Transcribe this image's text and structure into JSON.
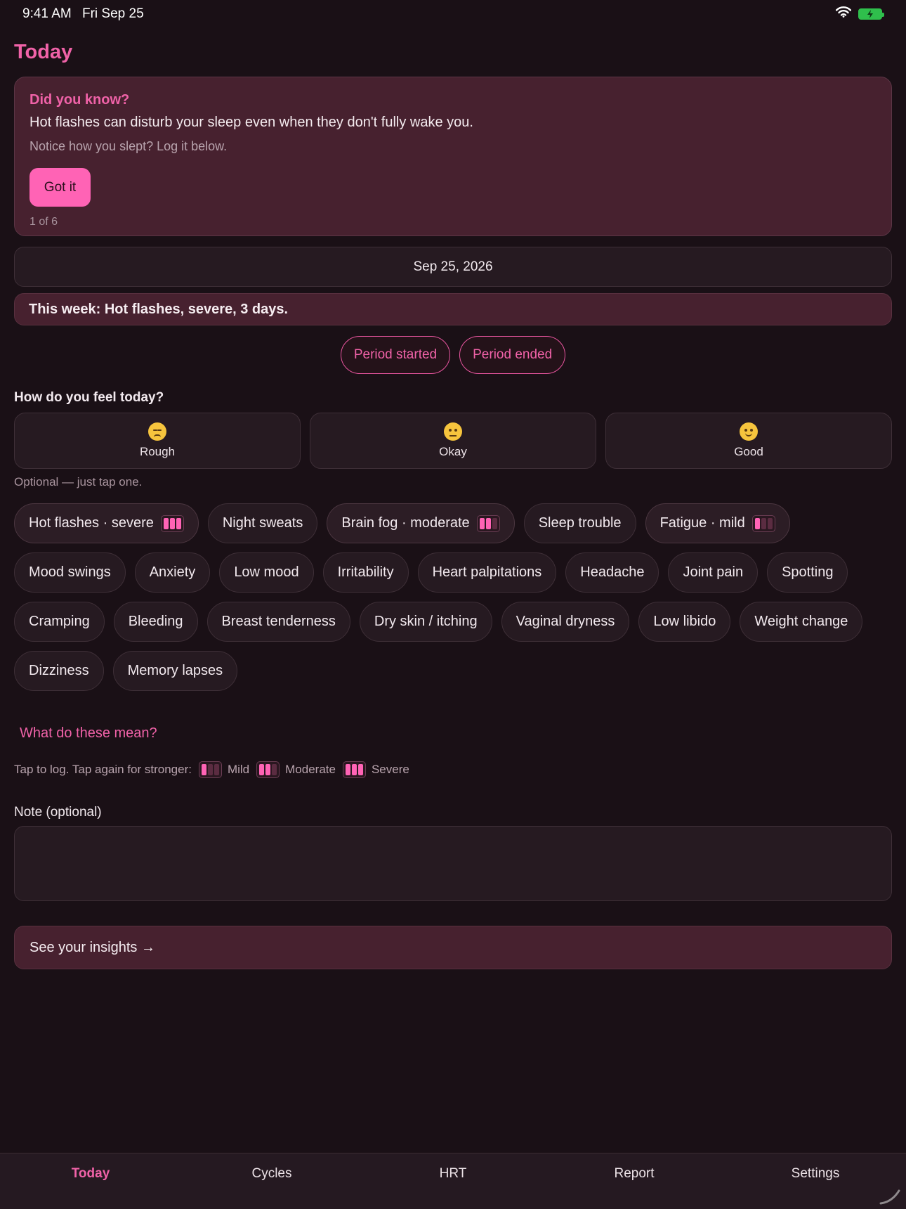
{
  "status_bar": {
    "time": "9:41 AM",
    "date": "Fri Sep 25"
  },
  "page_title": "Today",
  "tip": {
    "heading": "Did you know?",
    "body": "Hot flashes can disturb your sleep even when they don't fully wake you.",
    "sub": "Notice how you slept? Log it below.",
    "button": "Got it",
    "counter": "1 of 6"
  },
  "date": "Sep 25, 2026",
  "week_summary": "This week: Hot flashes, severe, 3 days.",
  "period": {
    "started": "Period started",
    "ended": "Period ended"
  },
  "feel": {
    "label": "How do you feel today?",
    "options": [
      {
        "label": "Rough",
        "icon": "persevering-face-icon"
      },
      {
        "label": "Okay",
        "icon": "neutral-face-icon"
      },
      {
        "label": "Good",
        "icon": "slightly-smiling-face-icon"
      }
    ],
    "hint": "Optional — just tap one."
  },
  "symptoms": [
    {
      "label": "Hot flashes · severe",
      "severity": 3
    },
    {
      "label": "Night sweats",
      "severity": 0
    },
    {
      "label": "Brain fog · moderate",
      "severity": 2
    },
    {
      "label": "Sleep trouble",
      "severity": 0
    },
    {
      "label": "Fatigue · mild",
      "severity": 1
    },
    {
      "label": "Mood swings",
      "severity": 0
    },
    {
      "label": "Anxiety",
      "severity": 0
    },
    {
      "label": "Low mood",
      "severity": 0
    },
    {
      "label": "Irritability",
      "severity": 0
    },
    {
      "label": "Heart palpitations",
      "severity": 0
    },
    {
      "label": "Headache",
      "severity": 0
    },
    {
      "label": "Joint pain",
      "severity": 0
    },
    {
      "label": "Spotting",
      "severity": 0
    },
    {
      "label": "Cramping",
      "severity": 0
    },
    {
      "label": "Bleeding",
      "severity": 0
    },
    {
      "label": "Breast tenderness",
      "severity": 0
    },
    {
      "label": "Dry skin / itching",
      "severity": 0
    },
    {
      "label": "Vaginal dryness",
      "severity": 0
    },
    {
      "label": "Low libido",
      "severity": 0
    },
    {
      "label": "Weight change",
      "severity": 0
    },
    {
      "label": "Dizziness",
      "severity": 0
    },
    {
      "label": "Memory lapses",
      "severity": 0
    }
  ],
  "meaning_link": "What do these mean?",
  "legend": {
    "intro": "Tap to log. Tap again for stronger:",
    "mild": "Mild",
    "moderate": "Moderate",
    "severe": "Severe"
  },
  "note": {
    "label": "Note (optional)",
    "value": ""
  },
  "insights_button": "See your insights →",
  "tabs": [
    "Today",
    "Cycles",
    "HRT",
    "Report",
    "Settings"
  ],
  "colors": {
    "accent": "#f062a8",
    "button": "#ff63b5",
    "background": "#1a1016",
    "card_highlight": "#47212f"
  }
}
